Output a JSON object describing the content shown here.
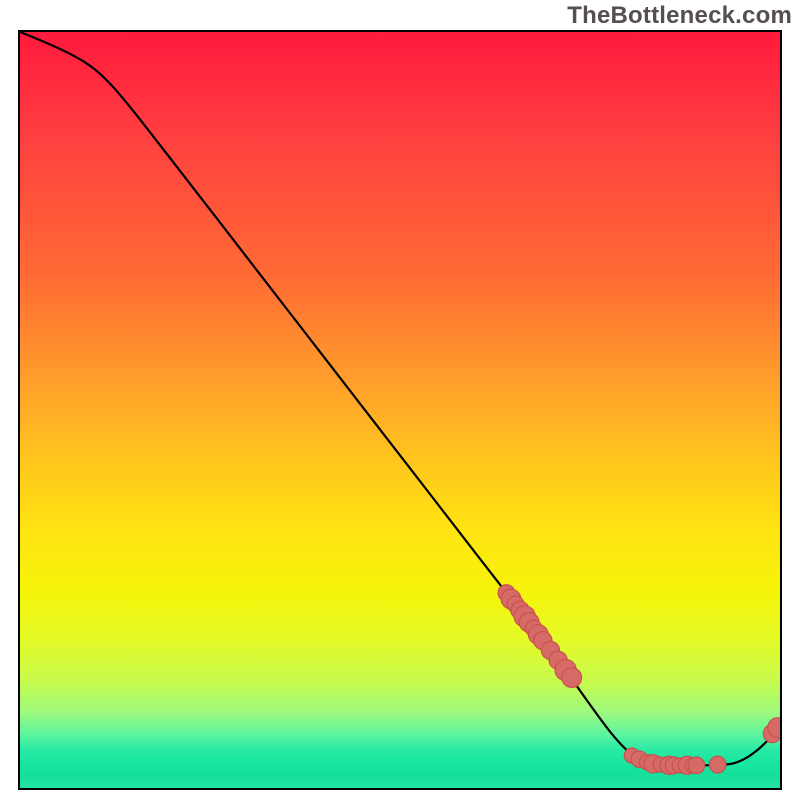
{
  "watermark": "TheBottleneck.com",
  "chart_data": {
    "type": "line",
    "title": "",
    "xlabel": "",
    "ylabel": "",
    "xlim": [
      0,
      100
    ],
    "ylim": [
      0,
      100
    ],
    "grid": false,
    "legend": false,
    "curve_points": [
      {
        "x": 0,
        "y": 100
      },
      {
        "x": 6,
        "y": 98
      },
      {
        "x": 12,
        "y": 93
      },
      {
        "x": 20,
        "y": 83
      },
      {
        "x": 30,
        "y": 70
      },
      {
        "x": 40,
        "y": 57
      },
      {
        "x": 50,
        "y": 44
      },
      {
        "x": 60,
        "y": 31
      },
      {
        "x": 70,
        "y": 18
      },
      {
        "x": 78,
        "y": 7
      },
      {
        "x": 82,
        "y": 3.5
      },
      {
        "x": 85,
        "y": 3
      },
      {
        "x": 90,
        "y": 3
      },
      {
        "x": 94,
        "y": 3.3
      },
      {
        "x": 97,
        "y": 5
      },
      {
        "x": 100,
        "y": 8
      }
    ],
    "marker_color": "#d66a67",
    "marker_stroke": "#c94f4c",
    "line_color": "#000000",
    "line_width": 2.2,
    "markers": [
      {
        "x": 64.0,
        "y": 25.8,
        "r": 1.1
      },
      {
        "x": 64.6,
        "y": 25.0,
        "r": 1.3
      },
      {
        "x": 65.2,
        "y": 24.3,
        "r": 1.1
      },
      {
        "x": 65.8,
        "y": 23.5,
        "r": 1.2
      },
      {
        "x": 66.4,
        "y": 22.7,
        "r": 1.4
      },
      {
        "x": 67.0,
        "y": 21.9,
        "r": 1.3
      },
      {
        "x": 67.6,
        "y": 21.1,
        "r": 1.1
      },
      {
        "x": 68.2,
        "y": 20.3,
        "r": 1.3
      },
      {
        "x": 68.8,
        "y": 19.5,
        "r": 1.2
      },
      {
        "x": 69.8,
        "y": 18.2,
        "r": 1.2
      },
      {
        "x": 70.8,
        "y": 16.9,
        "r": 1.2
      },
      {
        "x": 71.8,
        "y": 15.6,
        "r": 1.4
      },
      {
        "x": 72.6,
        "y": 14.6,
        "r": 1.3
      },
      {
        "x": 80.5,
        "y": 4.3,
        "r": 1.0
      },
      {
        "x": 81.5,
        "y": 3.8,
        "r": 1.1
      },
      {
        "x": 82.5,
        "y": 3.4,
        "r": 1.0
      },
      {
        "x": 83.3,
        "y": 3.2,
        "r": 1.2
      },
      {
        "x": 84.3,
        "y": 3.1,
        "r": 1.0
      },
      {
        "x": 85.4,
        "y": 3.0,
        "r": 1.2
      },
      {
        "x": 86.0,
        "y": 3.0,
        "r": 1.1
      },
      {
        "x": 86.8,
        "y": 3.0,
        "r": 1.0
      },
      {
        "x": 87.8,
        "y": 3.0,
        "r": 1.2
      },
      {
        "x": 88.5,
        "y": 3.0,
        "r": 1.0
      },
      {
        "x": 89.0,
        "y": 3.0,
        "r": 1.1
      },
      {
        "x": 91.8,
        "y": 3.1,
        "r": 1.1
      },
      {
        "x": 99.0,
        "y": 7.2,
        "r": 1.2
      },
      {
        "x": 99.7,
        "y": 8.0,
        "r": 1.3
      }
    ]
  }
}
